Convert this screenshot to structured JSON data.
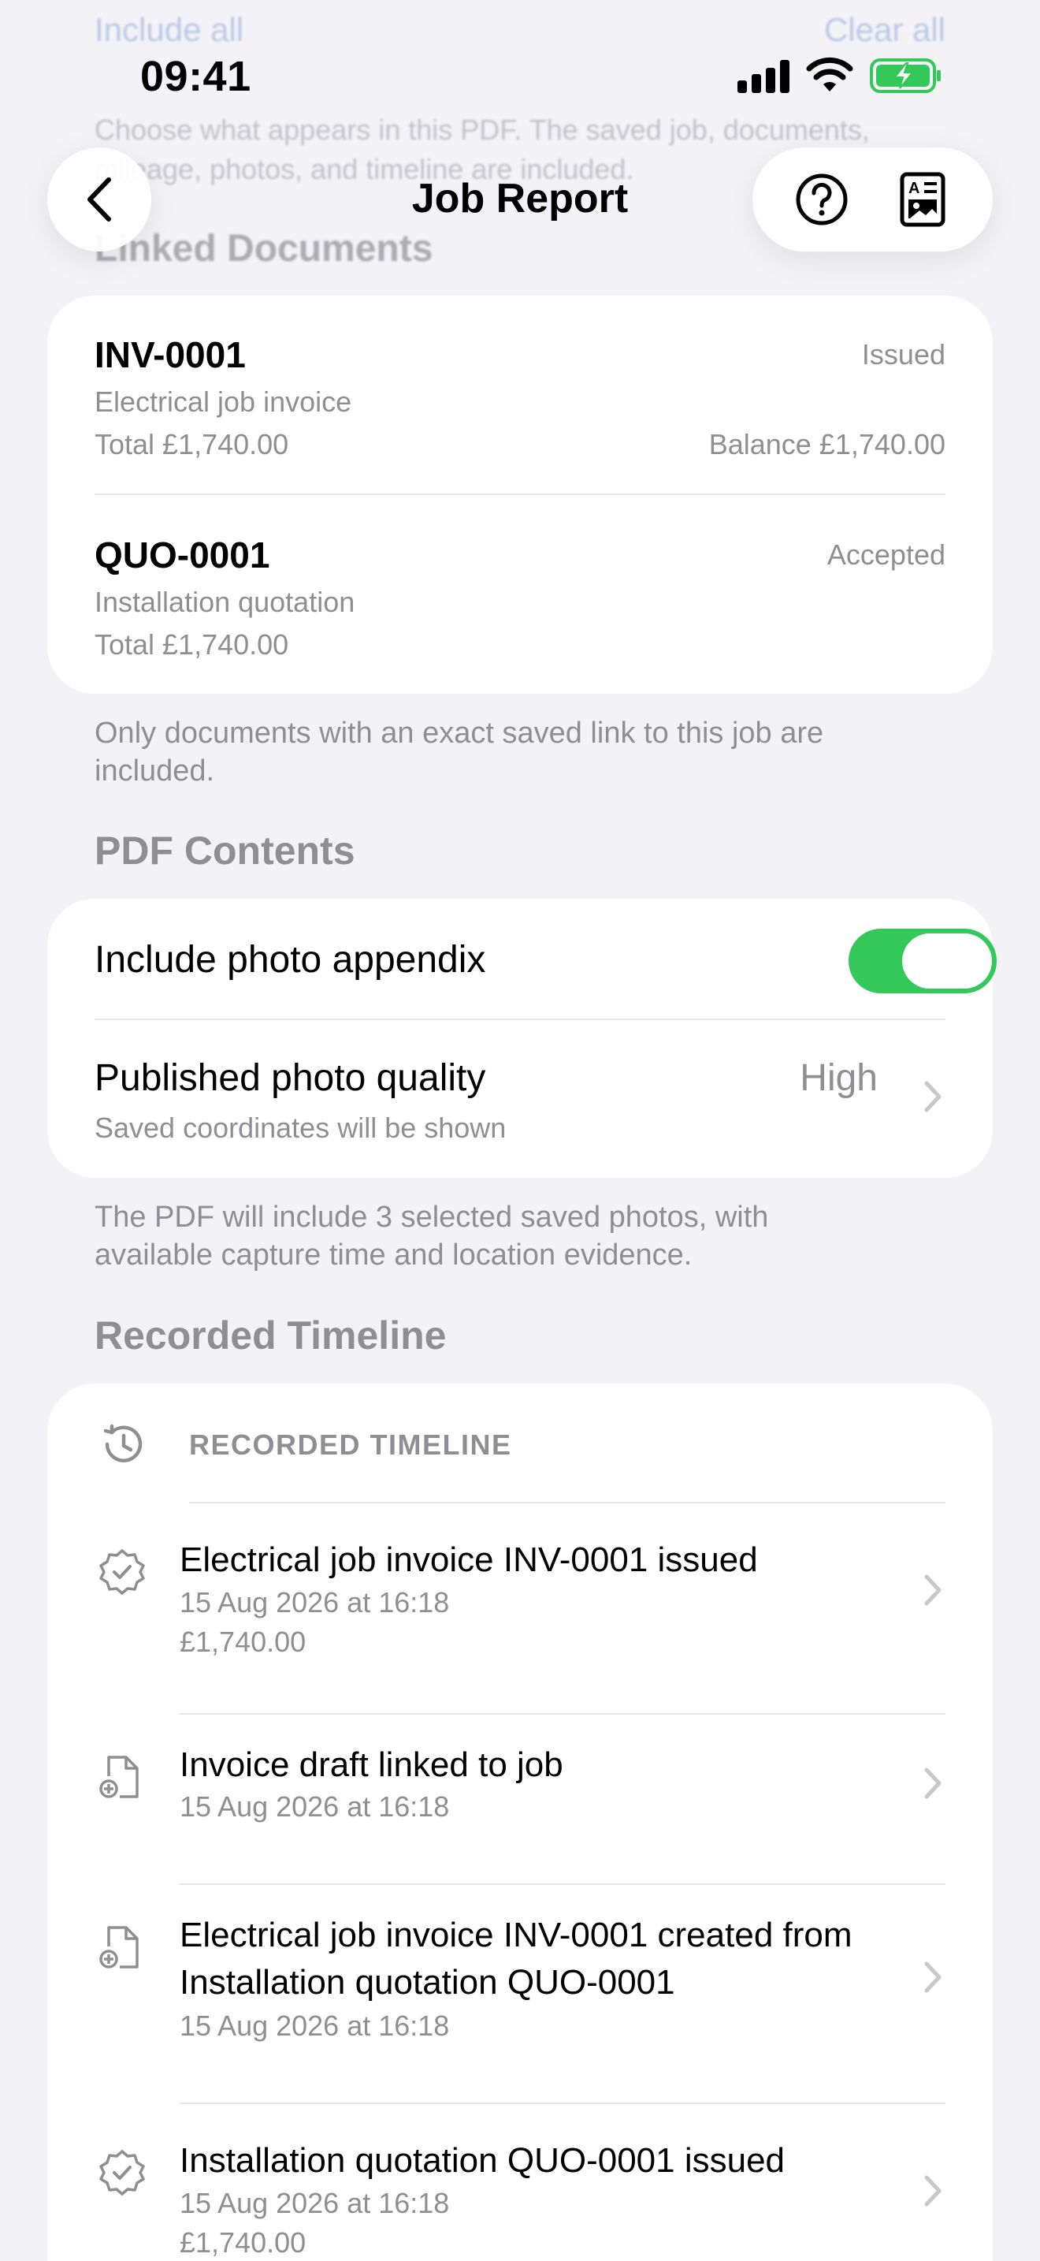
{
  "ghost": {
    "top_left": "Include all",
    "top_right": "Clear all",
    "description": "Choose what appears in this PDF. The saved job, documents, mileage, photos, and timeline are included.",
    "heading": "Linked Documents"
  },
  "status_bar": {
    "time": "09:41"
  },
  "nav": {
    "title": "Job Report"
  },
  "linked_documents": {
    "items": [
      {
        "id": "INV-0001",
        "status": "Issued",
        "description": "Electrical job invoice",
        "total": "Total £1,740.00",
        "balance": "Balance £1,740.00"
      },
      {
        "id": "QUO-0001",
        "status": "Accepted",
        "description": "Installation quotation",
        "total": "Total £1,740.00"
      }
    ],
    "footnote": "Only documents with an exact saved link to this job are included."
  },
  "pdf_contents": {
    "heading": "PDF Contents",
    "photo_appendix_label": "Include photo appendix",
    "photo_appendix_on": true,
    "quality_label": "Published photo quality",
    "quality_sub": "Saved coordinates will be shown",
    "quality_value": "High",
    "footnote": "The PDF will include 3 selected saved photos, with available capture time and location evidence."
  },
  "timeline": {
    "heading": "Recorded Timeline",
    "header_label": "RECORDED TIMELINE",
    "entries": [
      {
        "icon": "seal-check-icon",
        "title": "Electrical job invoice INV-0001 issued",
        "date": "15 Aug 2026 at 16:18",
        "amount": "£1,740.00"
      },
      {
        "icon": "document-plus-icon",
        "title": "Invoice draft linked to job",
        "date": "15 Aug 2026 at 16:18"
      },
      {
        "icon": "document-plus-icon",
        "title": "Electrical job invoice INV-0001 created from Installation quotation QUO-0001",
        "date": "15 Aug 2026 at 16:18"
      },
      {
        "icon": "seal-check-icon",
        "title": "Installation quotation QUO-0001 issued",
        "date": "15 Aug 2026 at 16:18",
        "amount": "£1,740.00"
      }
    ]
  },
  "colors": {
    "background": "#F2F2F7",
    "toggle_on": "#34C759",
    "secondary_text": "#8E8E93",
    "battery_charging": "#34C759"
  }
}
